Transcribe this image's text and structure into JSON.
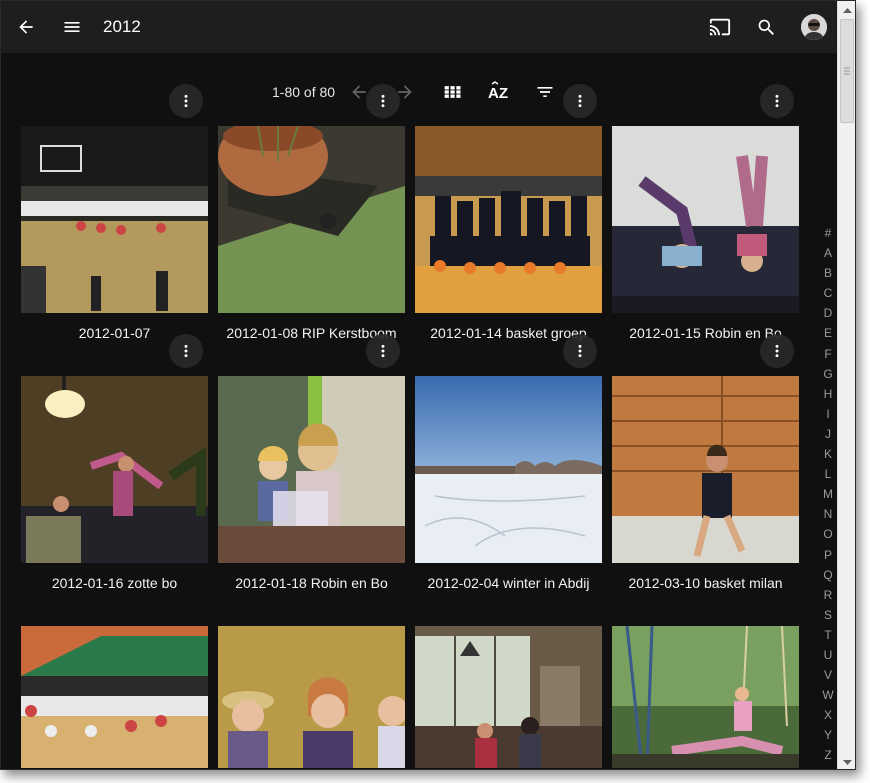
{
  "header": {
    "title": "2012"
  },
  "pager": {
    "range": "1-80 of 80"
  },
  "photos": [
    {
      "caption": "2012-01-07"
    },
    {
      "caption": "2012-01-08 RIP Kerstboom"
    },
    {
      "caption": "2012-01-14 basket groep"
    },
    {
      "caption": "2012-01-15 Robin en Bo"
    },
    {
      "caption": "2012-01-16 zotte bo"
    },
    {
      "caption": "2012-01-18 Robin en Bo"
    },
    {
      "caption": "2012-02-04 winter in Abdij"
    },
    {
      "caption": "2012-03-10 basket milan"
    },
    {
      "caption": ""
    },
    {
      "caption": ""
    },
    {
      "caption": ""
    },
    {
      "caption": ""
    }
  ],
  "alpha_index": [
    "#",
    "A",
    "B",
    "C",
    "D",
    "E",
    "F",
    "G",
    "H",
    "I",
    "J",
    "K",
    "L",
    "M",
    "N",
    "O",
    "P",
    "Q",
    "R",
    "S",
    "T",
    "U",
    "V",
    "W",
    "X",
    "Y",
    "Z"
  ],
  "icons": {
    "back": "arrow-left-icon",
    "menu": "hamburger-menu-icon",
    "cast": "cast-icon",
    "search": "search-icon",
    "prev": "chevron-left-arrow-icon",
    "next": "chevron-right-arrow-icon",
    "grid": "grid-view-icon",
    "sort": "sort-az-icon",
    "filter": "filter-icon",
    "more": "more-vert-icon"
  }
}
